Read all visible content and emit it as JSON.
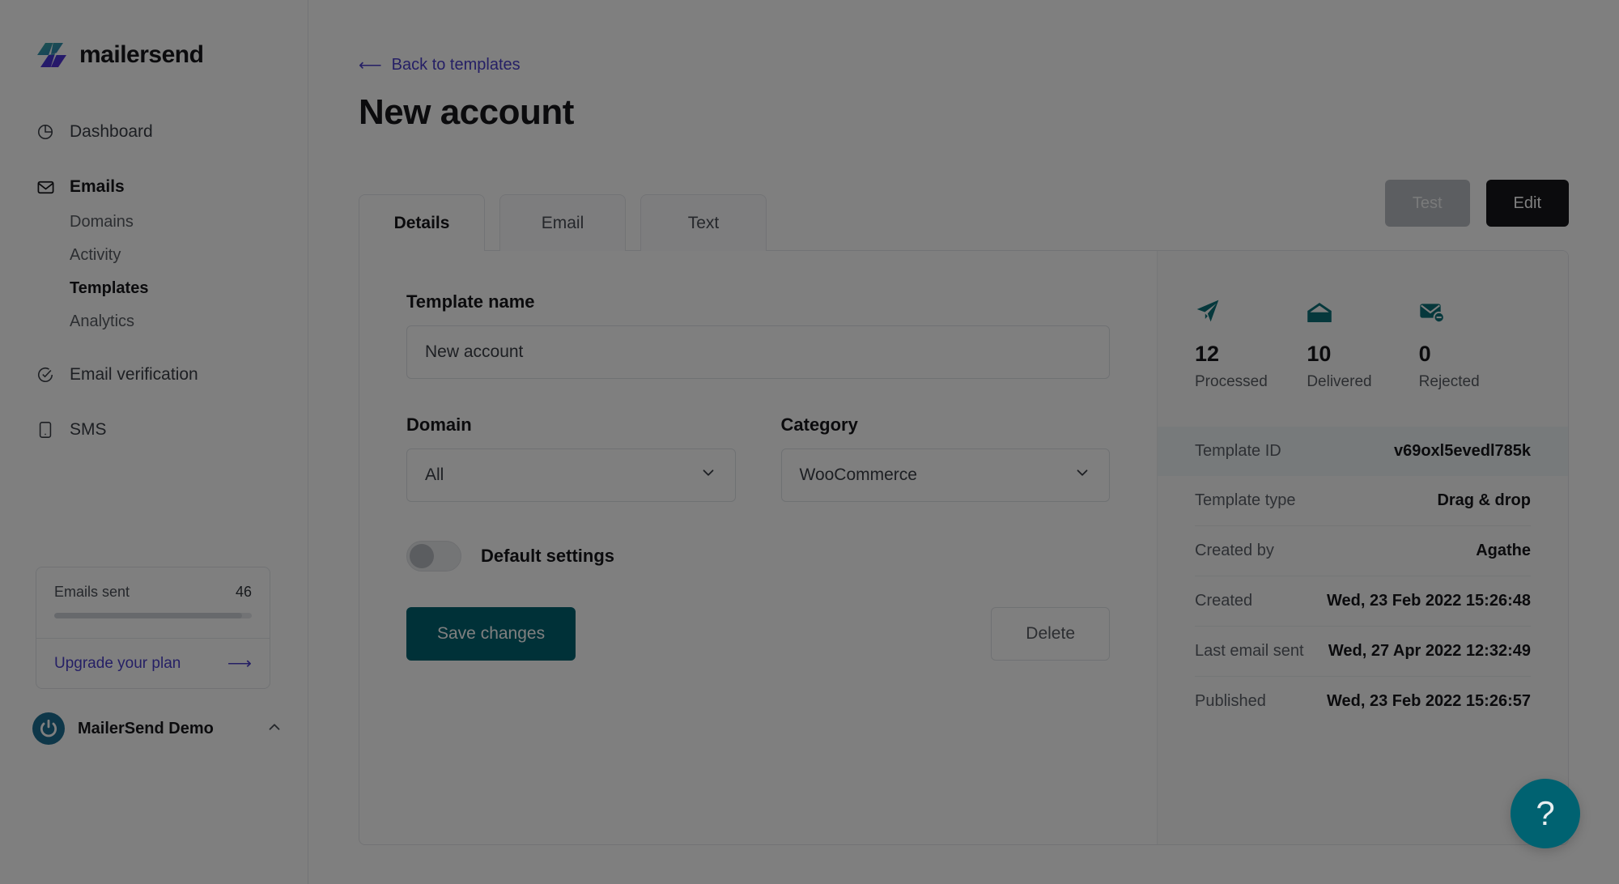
{
  "brand": {
    "name": "mailersend",
    "logo_colors": [
      "#2c9fa0",
      "#3b3fd4",
      "#5b2bd6"
    ]
  },
  "sidebar": {
    "nav": [
      {
        "label": "Dashboard",
        "icon": "pie-chart-icon",
        "bold": false
      },
      {
        "label": "Emails",
        "icon": "envelope-icon",
        "bold": true
      }
    ],
    "subnav": [
      {
        "label": "Domains",
        "active": false
      },
      {
        "label": "Activity",
        "active": false
      },
      {
        "label": "Templates",
        "active": true
      },
      {
        "label": "Analytics",
        "active": false
      }
    ],
    "nav2": [
      {
        "label": "Email verification",
        "icon": "check-circle-icon",
        "bold": false
      },
      {
        "label": "SMS",
        "icon": "mobile-icon",
        "bold": false
      }
    ],
    "usage": {
      "label": "Emails sent",
      "value": "46",
      "progress_percent": 95,
      "upgrade_label": "Upgrade your plan",
      "upgrade_arrow": "⟶"
    },
    "account": {
      "name": "MailerSend Demo",
      "chevron": "chevron-up-icon"
    }
  },
  "main": {
    "back_link": {
      "arrow": "⟵",
      "label": "Back to templates"
    },
    "page_title": "New account",
    "buttons": {
      "test": "Test",
      "edit": "Edit"
    },
    "tabs": [
      {
        "label": "Details",
        "active": true
      },
      {
        "label": "Email",
        "active": false
      },
      {
        "label": "Text",
        "active": false
      }
    ],
    "form": {
      "template_name_label": "Template name",
      "template_name_value": "New account",
      "template_name_placeholder": "Template name",
      "domain_label": "Domain",
      "domain_value": "All",
      "category_label": "Category",
      "category_value": "WooCommerce",
      "default_settings_label": "Default settings",
      "default_settings_on": false,
      "save_label": "Save changes",
      "delete_label": "Delete"
    },
    "stats": [
      {
        "icon": "paper-plane-icon",
        "value": "12",
        "label": "Processed"
      },
      {
        "icon": "open-envelope-icon",
        "value": "10",
        "label": "Delivered"
      },
      {
        "icon": "envelope-minus-icon",
        "value": "0",
        "label": "Rejected"
      }
    ],
    "meta": [
      {
        "key": "Template ID",
        "value": "v69oxl5evedl785k",
        "highlighted": true
      },
      {
        "key": "Template type",
        "value": "Drag & drop",
        "highlighted": false
      },
      {
        "key": "Created by",
        "value": "Agathe",
        "highlighted": false
      },
      {
        "key": "Created",
        "value": "Wed, 23 Feb 2022 15:26:48",
        "highlighted": false
      },
      {
        "key": "Last email sent",
        "value": "Wed, 27 Apr 2022 12:32:49",
        "highlighted": false
      },
      {
        "key": "Published",
        "value": "Wed, 23 Feb 2022 15:26:57",
        "highlighted": false
      }
    ],
    "help_fab": "?"
  },
  "colors": {
    "accent_teal": "#006271",
    "link_purple": "#4a3ecb",
    "dark": "#16161a",
    "highlight_row": "#eef5f6"
  }
}
